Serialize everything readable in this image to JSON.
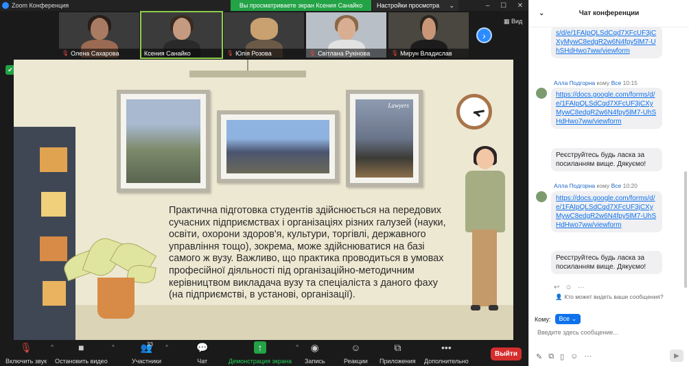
{
  "window": {
    "title": "Zoom Конференция",
    "share_banner": "Вы просматриваете экран Ксения Санайко",
    "view_options": "Настройки просмотра",
    "view_button": "Вид"
  },
  "participants": [
    {
      "name": "Олена Сахарова"
    },
    {
      "name": "Ксения Санайко"
    },
    {
      "name": "Юлія Розова"
    },
    {
      "name": "Світлана Рукінова"
    },
    {
      "name": "Мирун Владислав"
    }
  ],
  "slide": {
    "text": "Практична підготовка студентів здійснюється на передових сучасних підприємствах і організаціях різних галузей (науки, освіти, охорони здоров'я, культури, торгівлі, державного управління тощо), зокрема, може здійснюватися на базі самого ж вузу. Важливо, що практика проводиться в умовах професійної діяльності під організаційно-методичним керівництвом викладача вузу та спеціаліста з даного фаху (на підприємстві, в установі, організації).",
    "photo_caption": "Lawyers"
  },
  "toolbar": {
    "mute": "Включить звук",
    "video": "Остановить видео",
    "participants": "Участники",
    "participants_count": "33",
    "chat": "Чат",
    "share": "Демонстрация экрана",
    "record": "Запись",
    "reactions": "Реакции",
    "apps": "Приложения",
    "more": "Дополнительно",
    "leave": "Выйти"
  },
  "chat": {
    "title": "Чат конференции",
    "messages": [
      {
        "link": "s/d/e/1FAIpQLSdCqd7XFcUF3jCXyMywC8edgR2w6N4fpy5lM7-UhSHdHwo7ww/viewform"
      },
      {
        "sender": "Алла Подгорна",
        "to_word": "кому",
        "to": "Все",
        "time": "10:15",
        "link": "https://docs.google.com/forms/d/e/1FAIpQLSdCqd7XFcUF3jCXyMywC8edgR2w6N4fpy5lM7-UhSHdHwo7ww/viewform",
        "text": "Реєструйтесь будь ласка за посиланням вище. Дякуємо!"
      },
      {
        "sender": "Алла Подгорна",
        "to_word": "кому",
        "to": "Все",
        "time": "10:20",
        "link": "https://docs.google.com/forms/d/e/1FAIpQLSdCqd7XFcUF3jCXyMywC8edgR2w6N4fpy5lM7-UhSHdHwo7ww/viewform",
        "text": "Реєструйтесь будь ласка за посиланням вище. Дякуємо!"
      }
    ],
    "who_can_see": "Кто может видеть ваши сообщения?",
    "to_label": "Кому:",
    "to_value": "Все",
    "input_placeholder": "Введите здесь сообщение..."
  },
  "colors": {
    "accent": "#0e72ed",
    "share_green": "#23a246",
    "leave_red": "#d62e2e"
  }
}
